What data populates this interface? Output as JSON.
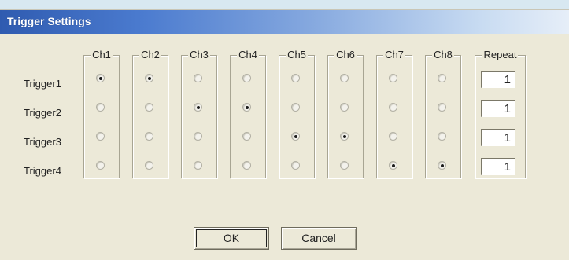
{
  "window": {
    "title": "Trigger Settings"
  },
  "channels": [
    "Ch1",
    "Ch2",
    "Ch3",
    "Ch4",
    "Ch5",
    "Ch6",
    "Ch7",
    "Ch8"
  ],
  "repeat_label": "Repeat",
  "triggers": [
    {
      "label": "Trigger1",
      "selected_channel": 0,
      "selected_channels": [
        0,
        1
      ],
      "repeat": "1"
    },
    {
      "label": "Trigger2",
      "selected_channels": [
        2,
        3
      ],
      "repeat": "1"
    },
    {
      "label": "Trigger3",
      "selected_channels": [
        4,
        5
      ],
      "repeat": "1"
    },
    {
      "label": "Trigger4",
      "selected_channels": [
        6,
        7
      ],
      "repeat": "1"
    }
  ],
  "buttons": {
    "ok": "OK",
    "cancel": "Cancel"
  }
}
